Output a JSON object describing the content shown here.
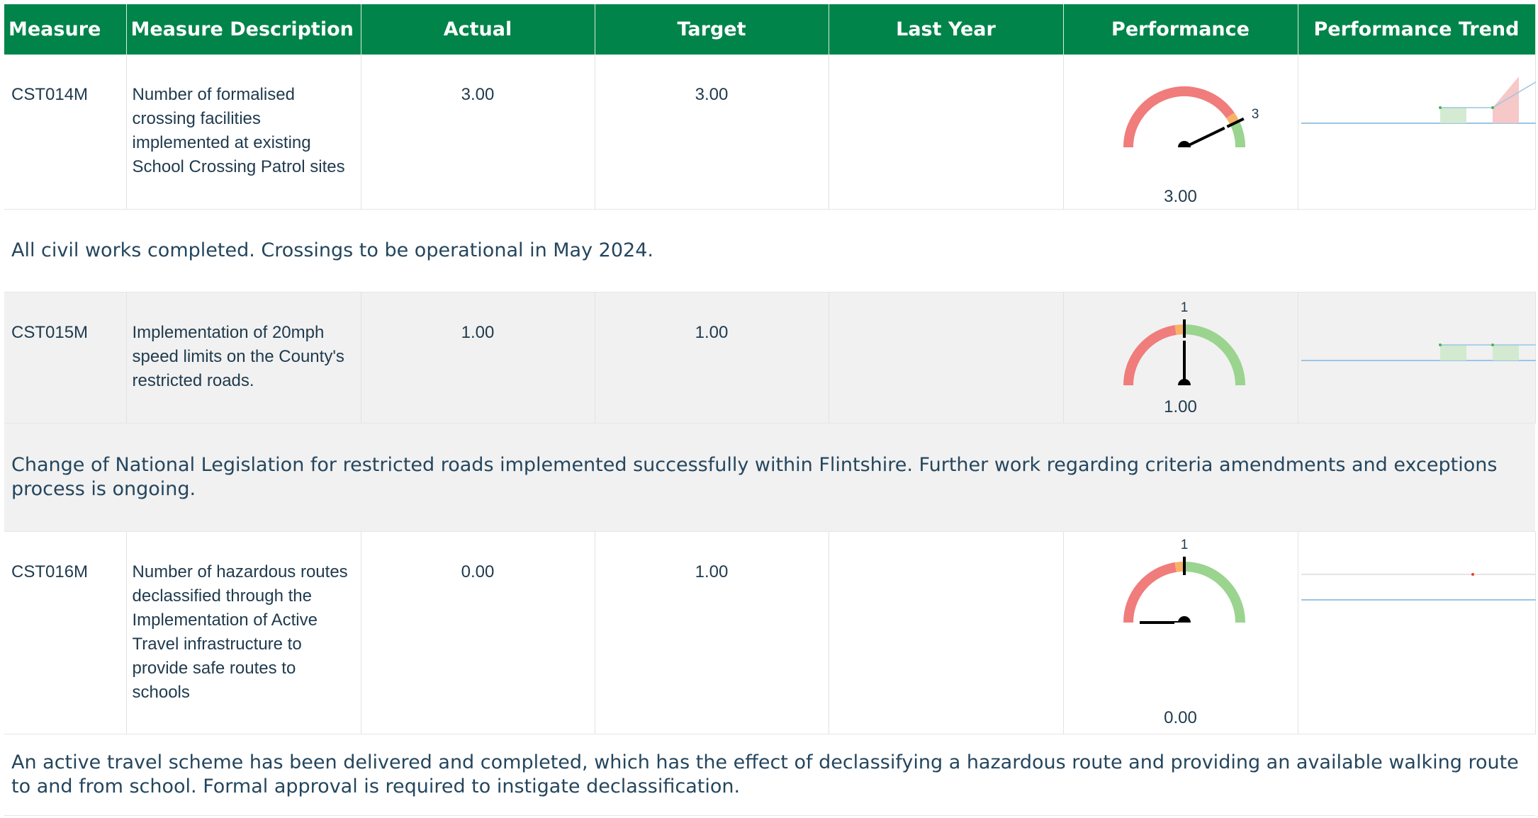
{
  "columns": {
    "measure": "Measure",
    "description": "Measure Description",
    "actual": "Actual",
    "target": "Target",
    "last_year": "Last Year",
    "performance": "Performance",
    "trend": "Performance Trend"
  },
  "colors": {
    "header_bg": "#00844a",
    "gauge_red": "#f07c7c",
    "gauge_amber": "#f7b267",
    "gauge_green": "#9ad48f",
    "trend_green": "#cfe9cc",
    "trend_red": "#f6c2c2",
    "trend_line": "#9ac6e4"
  },
  "rows": [
    {
      "code": "CST014M",
      "description": "Number of formalised crossing facilities implemented at existing School Crossing Patrol sites",
      "actual": "3.00",
      "target": "3.00",
      "last_year": "",
      "gauge": {
        "value_label": "3.00",
        "target_label": "3",
        "actual": 3,
        "target": 3,
        "max": 3.5
      },
      "trend": [
        1,
        1,
        3
      ],
      "comment": "All civil works completed. Crossings to be operational in May 2024."
    },
    {
      "code": "CST015M",
      "description": "Implementation of 20mph speed limits on the County's restricted roads.",
      "actual": "1.00",
      "target": "1.00",
      "last_year": "",
      "gauge": {
        "value_label": "1.00",
        "target_label": "1",
        "actual": 1,
        "target": 1,
        "max": 2
      },
      "trend": [
        1,
        1,
        1
      ],
      "comment": "Change of National Legislation for restricted roads implemented successfully within Flintshire. Further work regarding criteria amendments and exceptions process is ongoing."
    },
    {
      "code": "CST016M",
      "description": "Number of hazardous routes declassified through the Implementation of Active Travel infrastructure to provide safe routes to schools",
      "actual": "0.00",
      "target": "1.00",
      "last_year": "",
      "gauge": {
        "value_label": "0.00",
        "target_label": "1",
        "actual": 0,
        "target": 1,
        "max": 2
      },
      "trend": [
        0
      ],
      "comment": "An active travel scheme has been delivered and completed, which has the effect of declassifying a hazardous route and providing an available walking route to and from school. Formal approval is required to instigate declassification."
    }
  ]
}
